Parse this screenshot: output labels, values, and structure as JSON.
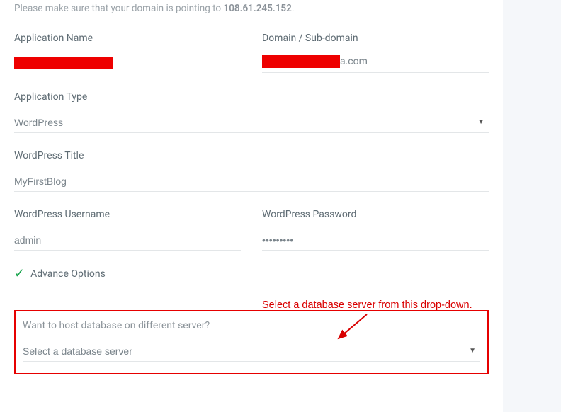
{
  "info": {
    "prefix": "Please make sure that your domain is pointing to ",
    "ip": "108.61.245.152",
    "suffix": "."
  },
  "fields": {
    "app_name_label": "Application Name",
    "domain_label": "Domain / Sub-domain",
    "domain_suffix": "a.com",
    "app_type_label": "Application Type",
    "app_type_value": "WordPress",
    "wp_title_label": "WordPress Title",
    "wp_title_value": "MyFirstBlog",
    "wp_user_label": "WordPress Username",
    "wp_user_value": "admin",
    "wp_pass_label": "WordPress Password",
    "wp_pass_value": "•••••••••"
  },
  "advance_label": "Advance Options",
  "annotation_text": "Select a database server from this drop-down.",
  "db": {
    "question": "Want to host database on different server?",
    "placeholder": "Select a database server"
  }
}
